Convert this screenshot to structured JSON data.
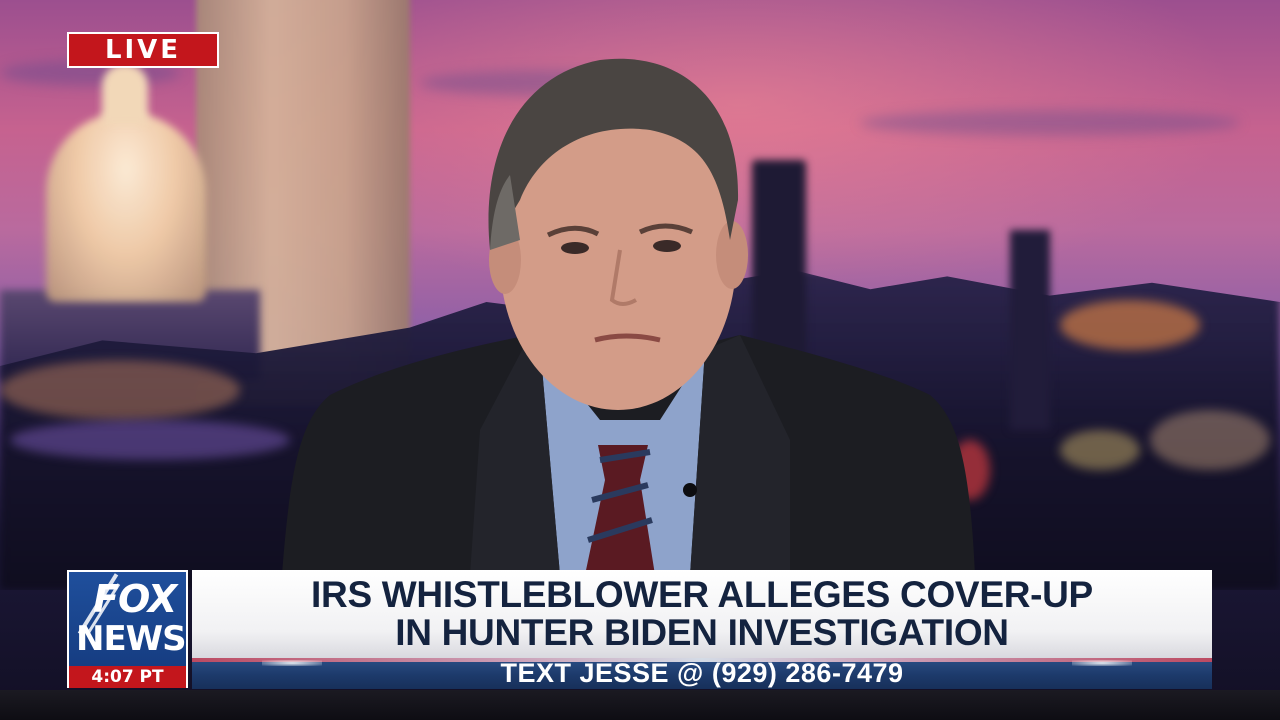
{
  "live_badge": {
    "label": "LIVE",
    "color": "#c3161c"
  },
  "logo": {
    "line1": "FOX",
    "line2": "NEWS",
    "time": "4:07 PT",
    "brand_blue": "#1f4f9c",
    "brand_red": "#c3161c"
  },
  "headline": {
    "line1": "IRS WHISTLEBLOWER ALLEGES COVER-UP",
    "line2": "IN HUNTER BIDEN INVESTIGATION",
    "text_color": "#14233f"
  },
  "ticker": {
    "text": "TEXT JESSE @ (929) 286-7479"
  }
}
